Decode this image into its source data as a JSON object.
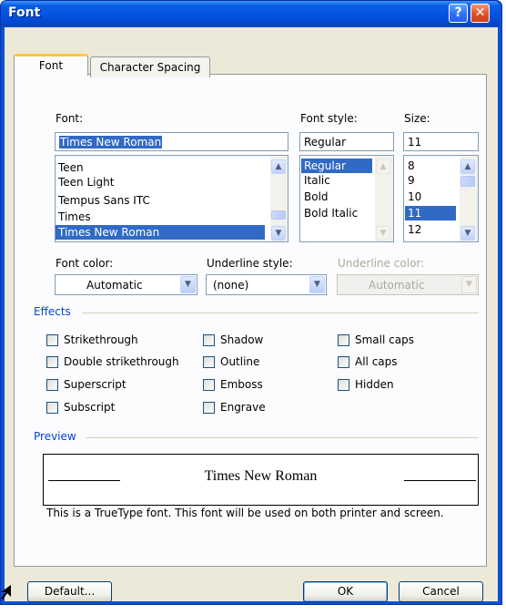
{
  "window": {
    "title": "Font",
    "help_label": "?",
    "close_label": "✕",
    "title_bar_color": "#0554e0"
  },
  "tabs": [
    {
      "label": "Font",
      "selected": true
    },
    {
      "label": "Character Spacing",
      "selected": false
    }
  ],
  "font": {
    "label": "Font:",
    "value": "Times New Roman",
    "items": [
      "Teen",
      "Teen Light",
      "Tempus Sans ITC",
      "Times",
      "Times New Roman"
    ],
    "selected": "Times New Roman"
  },
  "font_style": {
    "label": "Font style:",
    "value": "Regular",
    "items": [
      "Regular",
      "Italic",
      "Bold",
      "Bold Italic"
    ],
    "selected": "Regular"
  },
  "size": {
    "label": "Size:",
    "value": "11",
    "items": [
      "8",
      "9",
      "10",
      "11",
      "12"
    ],
    "selected": "11"
  },
  "font_color": {
    "label": "Font color:",
    "value": "Automatic"
  },
  "underline_style": {
    "label": "Underline style:",
    "value": "(none)"
  },
  "underline_color": {
    "label": "Underline color:",
    "value": "Automatic",
    "disabled": true
  },
  "effects": {
    "title": "Effects",
    "col1": [
      "Strikethrough",
      "Double strikethrough",
      "Superscript",
      "Subscript"
    ],
    "col2": [
      "Shadow",
      "Outline",
      "Emboss",
      "Engrave"
    ],
    "col3": [
      "Small caps",
      "All caps",
      "Hidden"
    ]
  },
  "preview": {
    "title": "Preview",
    "sample": "Times New Roman",
    "description": "This is a TrueType font. This font will be used on both printer and screen."
  },
  "buttons": {
    "default": "Default...",
    "ok": "OK",
    "cancel": "Cancel"
  },
  "icons": {
    "scroll_up": "▲",
    "scroll_down": "▼",
    "dropdown": "▼"
  }
}
